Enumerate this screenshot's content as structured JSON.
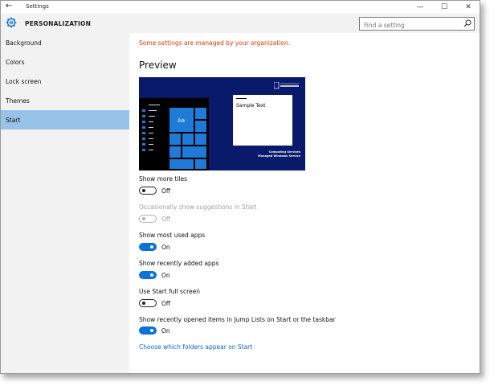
{
  "titlebar": {
    "back": "←",
    "title": "Settings",
    "minimize": "—",
    "maximize": "☐",
    "close": "✕"
  },
  "header": {
    "app_title": "PERSONALIZATION",
    "search_placeholder": "Find a setting"
  },
  "sidebar": {
    "items": [
      {
        "label": "Background"
      },
      {
        "label": "Colors"
      },
      {
        "label": "Lock screen"
      },
      {
        "label": "Themes"
      },
      {
        "label": "Start"
      }
    ],
    "active": "Start"
  },
  "main": {
    "org_message": "Some settings are managed by your organization.",
    "preview_heading": "Preview",
    "preview": {
      "sample_text": "Sample Text",
      "tile_text": "Aa",
      "org_line1": "Computing Services",
      "org_line2": "Managed Windows Service"
    },
    "settings": [
      {
        "label": "Show more tiles",
        "state": "Off",
        "on": false,
        "disabled": false
      },
      {
        "label": "Occasionally show suggestions in Start",
        "state": "Off",
        "on": false,
        "disabled": true
      },
      {
        "label": "Show most used apps",
        "state": "On",
        "on": true,
        "disabled": false
      },
      {
        "label": "Show recently added apps",
        "state": "On",
        "on": true,
        "disabled": false
      },
      {
        "label": "Use Start full screen",
        "state": "Off",
        "on": false,
        "disabled": false
      },
      {
        "label": "Show recently opened items in Jump Lists on Start or the taskbar",
        "state": "On",
        "on": true,
        "disabled": false
      }
    ],
    "link": "Choose which folders appear on Start"
  },
  "colors": {
    "accent": "#0a72d8",
    "sidebar_active": "#98c3e9",
    "warning": "#d83b01",
    "preview_bg": "#0a1a6b",
    "link": "#0a66c2"
  }
}
